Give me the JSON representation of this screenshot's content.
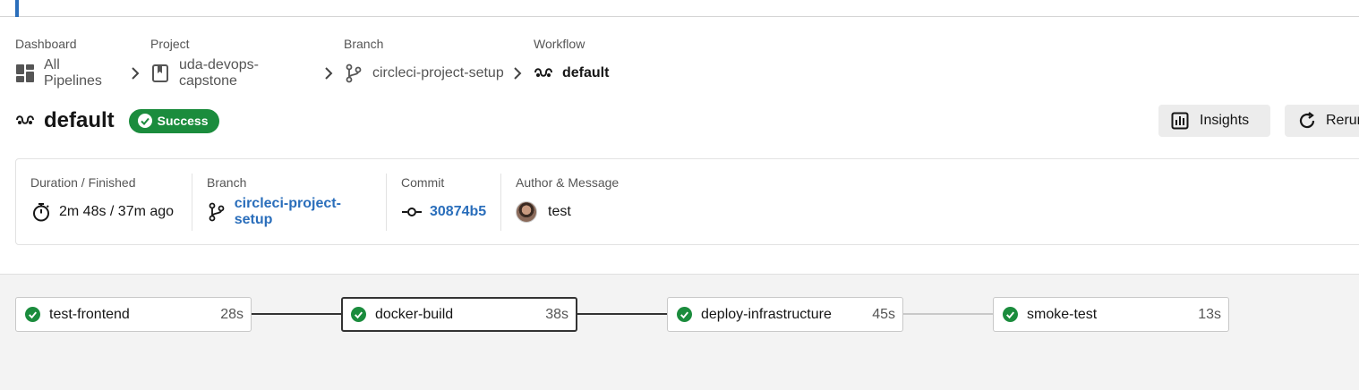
{
  "breadcrumbs": [
    {
      "caption": "Dashboard",
      "label": "All Pipelines",
      "icon": "dashboard-icon"
    },
    {
      "caption": "Project",
      "label": "uda-devops-capstone",
      "icon": "project-bookmark-icon"
    },
    {
      "caption": "Branch",
      "label": "circleci-project-setup",
      "icon": "branch-icon"
    },
    {
      "caption": "Workflow",
      "label": "default",
      "icon": "workflow-icon"
    }
  ],
  "workflow": {
    "title": "default",
    "status": "Success",
    "status_color": "#1b8c3d"
  },
  "actions": {
    "insights_label": "Insights",
    "rerun_label": "Rerun"
  },
  "summary": {
    "duration_caption": "Duration / Finished",
    "duration_value": "2m 48s / 37m ago",
    "branch_caption": "Branch",
    "branch_value": "circleci-project-setup",
    "commit_caption": "Commit",
    "commit_value": "30874b5",
    "author_caption": "Author & Message",
    "author_message": "test"
  },
  "jobs": [
    {
      "name": "test-frontend",
      "duration": "28s"
    },
    {
      "name": "docker-build",
      "duration": "38s"
    },
    {
      "name": "deploy-infrastructure",
      "duration": "45s"
    },
    {
      "name": "smoke-test",
      "duration": "13s"
    }
  ],
  "colors": {
    "accent": "#2a6ebb",
    "success": "#1b8c3d",
    "link": "#2a6ebb"
  }
}
